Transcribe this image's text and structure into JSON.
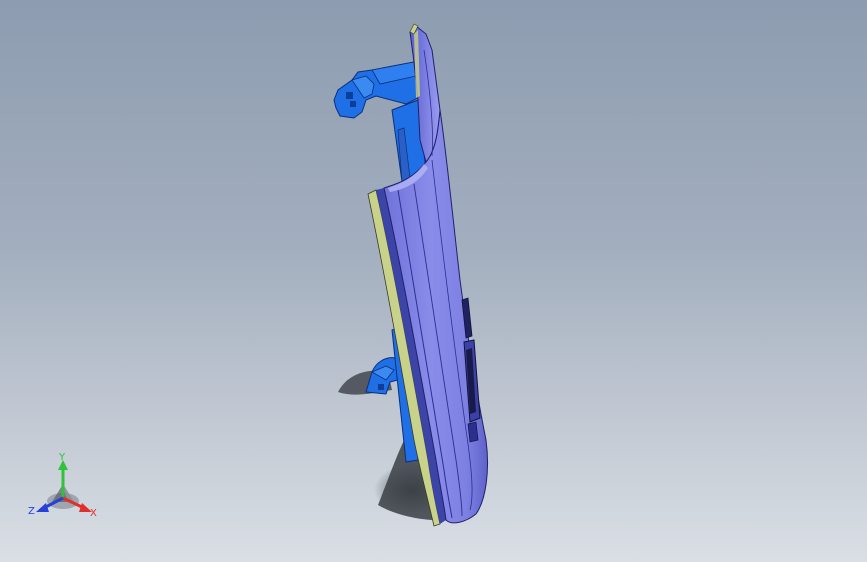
{
  "viewport": {
    "background_top": "#8d9cb0",
    "background_bottom": "#dadfe5"
  },
  "model": {
    "surface_color": "#7b7ee0",
    "highlight_color": "#a2a4f2",
    "bracket_color": "#1f6fe6",
    "edge_color": "#c9d28a",
    "shadow_color": "#3a3f48"
  },
  "triad": {
    "x_label": "X",
    "y_label": "Y",
    "z_label": "Z",
    "x_color": "#e0302a",
    "y_color": "#2fc23a",
    "z_color": "#2740d8"
  }
}
